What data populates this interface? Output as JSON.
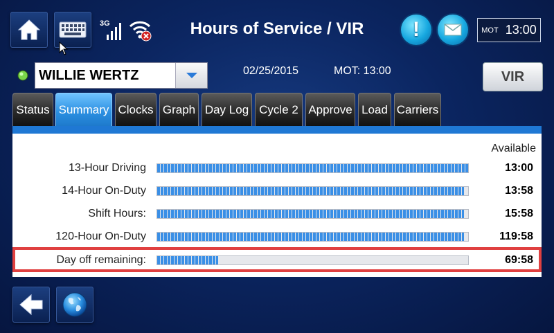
{
  "header": {
    "title": "Hours of Service / VIR",
    "network_label": "3G",
    "clock": {
      "zone_label": "MOT",
      "time": "13:00"
    }
  },
  "driver": {
    "name": "WILLIE WERTZ",
    "status_color": "#7ad64a"
  },
  "info": {
    "date": "02/25/2015",
    "mot_time": "MOT: 13:00"
  },
  "vir_button_label": "VIR",
  "tabs": [
    {
      "label": "Status",
      "active": false
    },
    {
      "label": "Summary",
      "active": true
    },
    {
      "label": "Clocks",
      "active": false
    },
    {
      "label": "Graph",
      "active": false
    },
    {
      "label": "Day Log",
      "active": false
    },
    {
      "label": "Cycle 2",
      "active": false
    },
    {
      "label": "Approve",
      "active": false
    },
    {
      "label": "Load",
      "active": false
    },
    {
      "label": "Carriers",
      "active": false
    }
  ],
  "summary": {
    "available_header": "Available",
    "rows": [
      {
        "label": "13-Hour Driving",
        "value": "13:00",
        "fill_fraction": 1.0
      },
      {
        "label": "14-Hour On-Duty",
        "value": "13:58",
        "fill_fraction": 0.987
      },
      {
        "label": "Shift Hours:",
        "value": "15:58",
        "fill_fraction": 0.987
      },
      {
        "label": "120-Hour On-Duty",
        "value": "119:58",
        "fill_fraction": 0.987
      },
      {
        "label": "Day off remaining:",
        "value": "69:58",
        "fill_fraction": 0.195
      }
    ]
  },
  "colors": {
    "accent_blue": "#1f78d4",
    "highlight_red": "#e04040"
  }
}
